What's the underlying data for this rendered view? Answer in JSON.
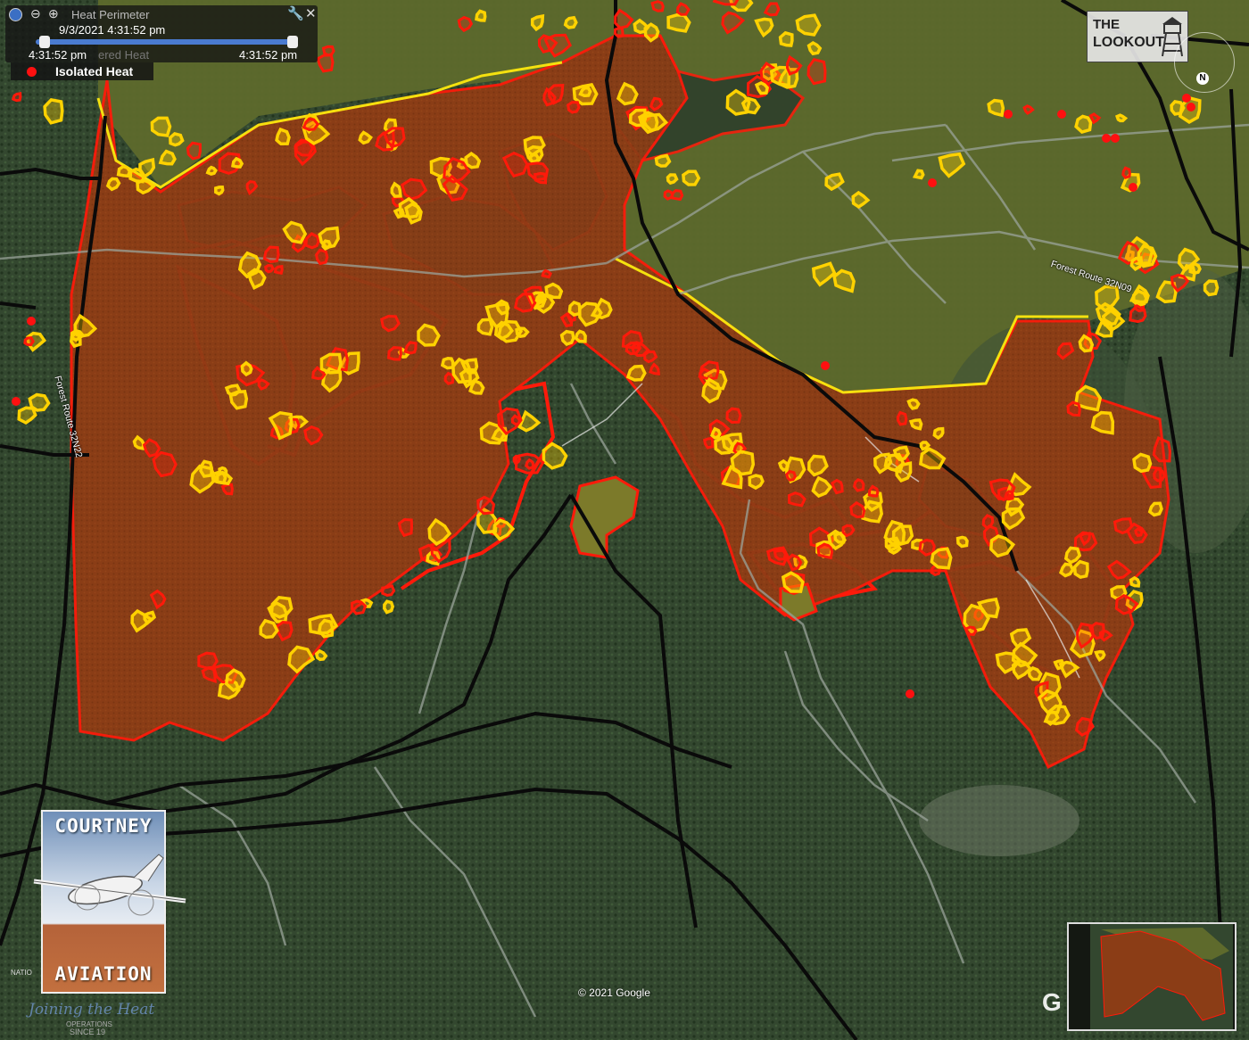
{
  "toolbar": {
    "layer_title": "Heat Perimeter",
    "time_top": "9/3/2021  4:31:52 pm",
    "time_left": "4:31:52 pm",
    "time_right": "4:31:52 pm",
    "partial_label_1": "ered Heat",
    "legend_isolated": "Isolated Heat"
  },
  "colors": {
    "burn_fill": "#8a3a14",
    "perimeter_red": "#ff1a0a",
    "heat_yellow": "#ffd200",
    "perimeter_yellow": "#f4e10f",
    "isolated_heat": "#ff1010",
    "road_black": "#0a0a0a",
    "forest_green": "#2f4a2c",
    "meadow_olive": "#66702f"
  },
  "logos": {
    "lookout_line1": "THE",
    "lookout_line2": "LOOKOUT",
    "compass_north": "N",
    "courtney_top": "COURTNEY",
    "courtney_bottom": "AVIATION",
    "badge_nation": "NATIO",
    "badge_script": "Joining the Heat",
    "badge_ops": "OPERATIONS",
    "badge_since": "SINCE 19"
  },
  "roads": {
    "label_32n22": "Forest Route 32N22",
    "label_32n09": "Forest Route 32N09"
  },
  "footer": {
    "copyright": "© 2021 Google",
    "google_mark": "G"
  }
}
